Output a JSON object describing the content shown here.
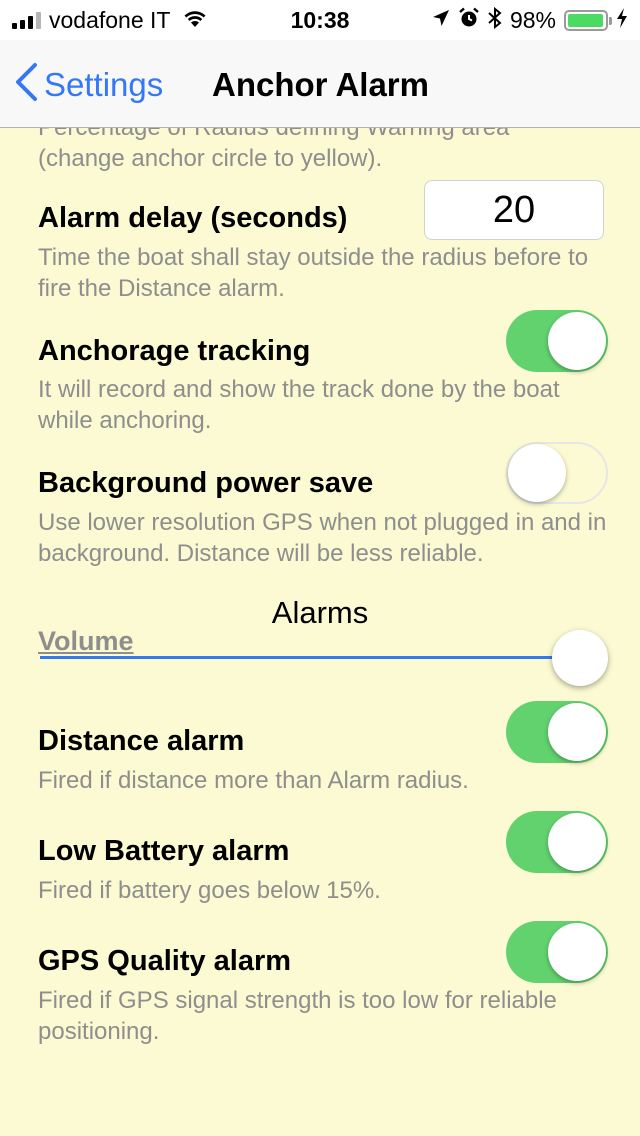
{
  "statusbar": {
    "carrier": "vodafone IT",
    "time": "10:38",
    "battery_percent": "98%",
    "battery_level": 0.98,
    "icons": [
      "signal-icon",
      "wifi-icon",
      "location-icon",
      "alarm-icon",
      "bluetooth-icon",
      "battery-icon",
      "charging-icon"
    ]
  },
  "navbar": {
    "back_label": "Settings",
    "title": "Anchor Alarm"
  },
  "settings": {
    "warning_area_cut": "Percentage of Radius defining Warning area",
    "warning_area_desc": "(change anchor circle to yellow).",
    "alarm_delay": {
      "title": "Alarm delay (seconds)",
      "value": "20",
      "desc": "Time the boat shall stay outside the radius before to fire the Distance alarm."
    },
    "anchorage_tracking": {
      "title": "Anchorage tracking",
      "enabled": true,
      "desc": "It will record and show the track done by the boat while anchoring."
    },
    "background_power_save": {
      "title": "Background power save",
      "enabled": false,
      "desc": "Use lower resolution GPS when not plugged in and in background. Distance will be less reliable."
    }
  },
  "alarms_section": {
    "header": "Alarms",
    "volume_label": "Volume",
    "volume_level": 1.0,
    "distance_alarm": {
      "title": "Distance alarm",
      "enabled": true,
      "desc": "Fired if distance more than Alarm radius."
    },
    "low_battery_alarm": {
      "title": "Low Battery alarm",
      "enabled": true,
      "desc": "Fired if battery goes below 15%."
    },
    "gps_quality_alarm": {
      "title": "GPS Quality alarm",
      "enabled": true,
      "desc": "Fired if GPS signal strength is too low for reliable positioning."
    }
  },
  "colors": {
    "background": "#fbfad2",
    "accent": "#3478f6",
    "switch_on": "#62d26f",
    "battery_fill": "#4cd964"
  }
}
